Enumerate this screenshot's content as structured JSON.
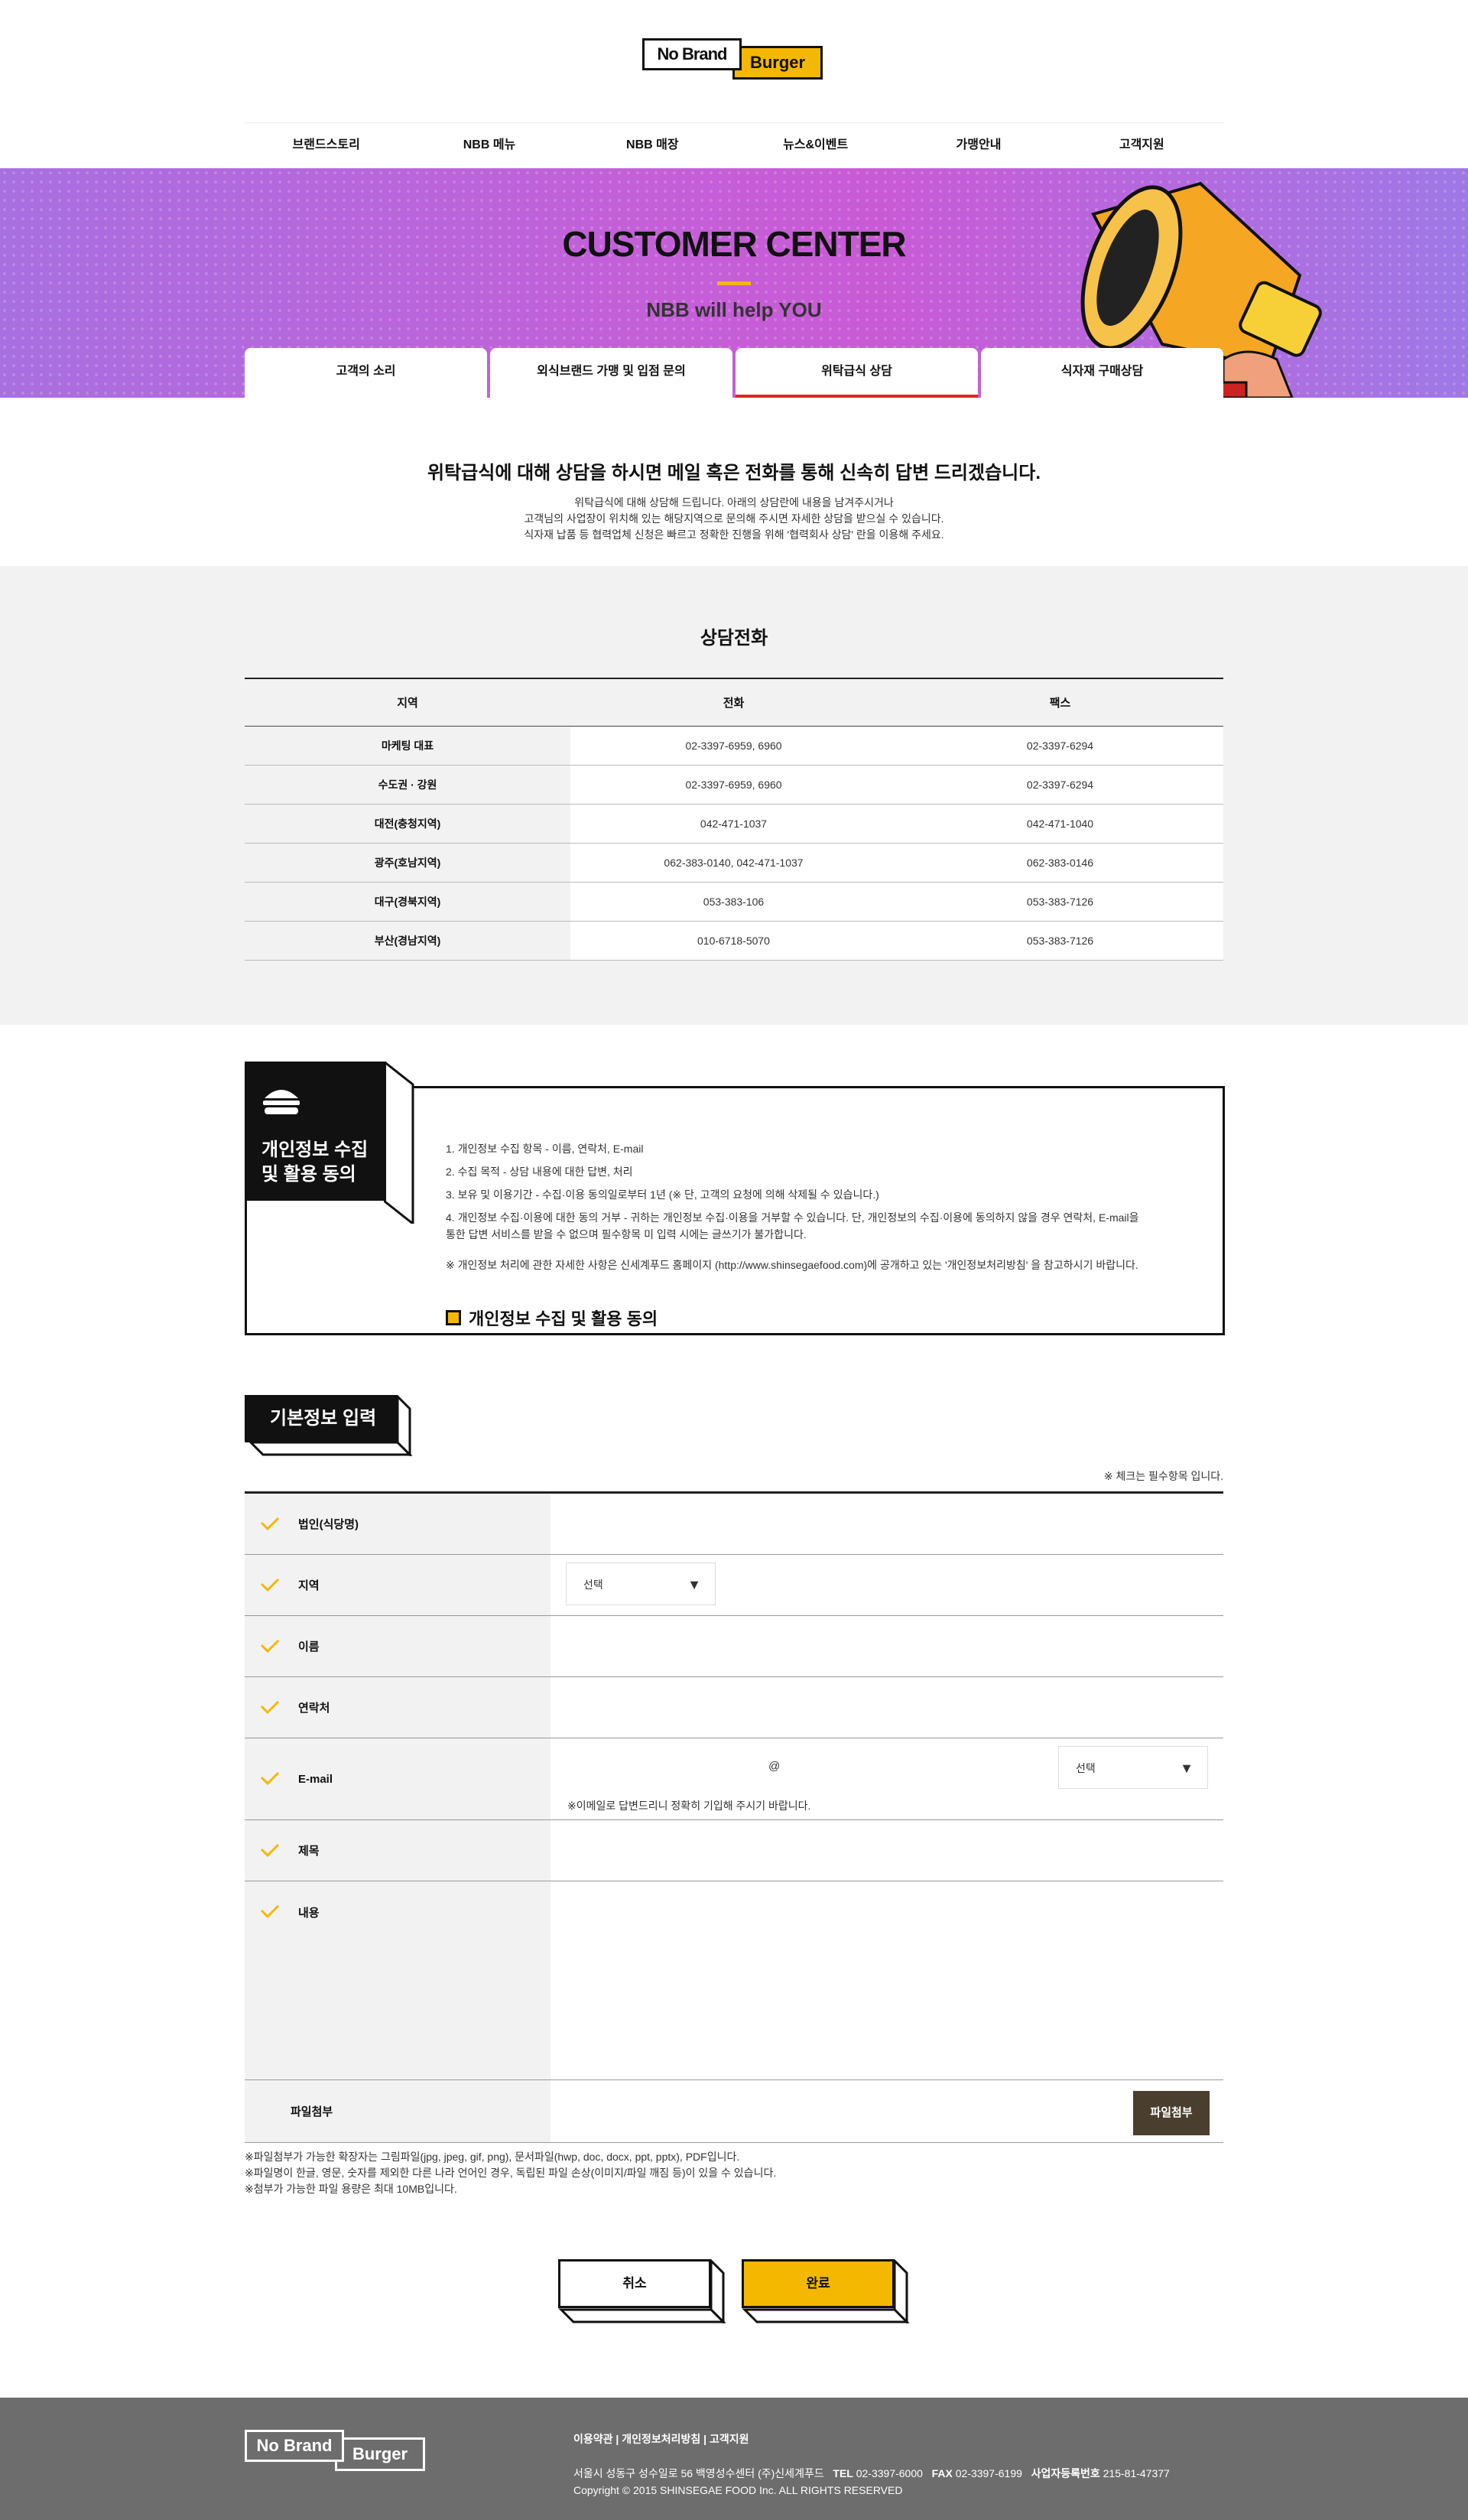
{
  "brand": {
    "logo_left": "No Brand",
    "logo_right": "Burger"
  },
  "nav": [
    "브랜드스토리",
    "NBB 메뉴",
    "NBB 매장",
    "뉴스&이벤트",
    "가맹안내",
    "고객지원"
  ],
  "hero": {
    "title": "CUSTOMER CENTER",
    "subtitle": "NBB will help YOU"
  },
  "tabs": [
    "고객의 소리",
    "외식브랜드 가맹 및 입점 문의",
    "위탁급식 상담",
    "식자재 구매상담"
  ],
  "intro": {
    "heading": "위탁급식에 대해 상담을 하시면 메일 혹은 전화를 통해 신속히 답변 드리겠습니다.",
    "line1": "위탁급식에 대해 상담해 드립니다. 아래의 상담란에 내용을 남겨주시거나",
    "line2": "고객님의 사업장이 위치해 있는 해당지역으로 문의해 주시면 자세한 상담을 받으실 수 있습니다.",
    "line3": "식자재 납품 등 협력업체 신청은 빠르고 정확한 진행을 위해 '협력회사 상담' 란을 이용해 주세요."
  },
  "phone": {
    "title": "상담전화",
    "headers": [
      "지역",
      "전화",
      "팩스"
    ],
    "rows": [
      [
        "마케팅 대표",
        "02-3397-6959, 6960",
        "02-3397-6294"
      ],
      [
        "수도권 · 강원",
        "02-3397-6959, 6960",
        "02-3397-6294"
      ],
      [
        "대전(충청지역)",
        "042-471-1037",
        "042-471-1040"
      ],
      [
        "광주(호남지역)",
        "062-383-0140, 042-471-1037",
        "062-383-0146"
      ],
      [
        "대구(경북지역)",
        "053-383-106",
        "053-383-7126"
      ],
      [
        "부산(경남지역)",
        "010-6718-5070",
        "053-383-7126"
      ]
    ]
  },
  "privacy": {
    "tag_line1": "개인정보 수집",
    "tag_line2": "및 활용 동의",
    "item1": "1. 개인정보 수집 항목  - 이름, 연락처, E-mail",
    "item2": "2. 수집 목적  - 상담 내용에 대한 답변, 처리",
    "item3": "3. 보유 및 이용기간  - 수집·이용 동의일로부터 1년 (※ 단, 고객의 요청에 의해 삭제될 수 있습니다.)",
    "item4a": "4. 개인정보 수집·이용에 대한 동의 거부  - 귀하는 개인정보 수집·이용을 거부할 수 있습니다. 단, 개인정보의 수집·이용에 동의하지 않을 경우 연락처, E-mail을",
    "item4b": "통한 답변 서비스를 받을 수 없으며 필수항목 미 입력 시에는 글쓰기가 불가합니다.",
    "note": "※ 개인정보 처리에 관한 자세한 사항은 신세계푸드 홈페이지 (http://www.shinsegaefood.com)에 공개하고 있는 '개인정보처리방침' 을 참고하시기 바랍니다.",
    "agree_label": "개인정보 수집 및 활용 동의"
  },
  "basic": {
    "tag": "기본정보 입력",
    "required_note": "※ 체크는 필수항목 입니다.",
    "labels": {
      "corp": "법인(식당명)",
      "region": "지역",
      "name": "이름",
      "contact": "연락처",
      "email": "E-mail",
      "subject": "제목",
      "content": "내용",
      "file": "파일첨부"
    },
    "region_select": "선택",
    "email_at": "@",
    "email_select": "선택",
    "email_note": "※이메일로 답변드리니 정확히 기입해 주시기 바랍니다.",
    "file_button": "파일첨부",
    "file_note1": "※파일첨부가 가능한 확장자는 그림파일(jpg, jpeg, gif, png), 문서파일(hwp, doc, docx, ppt, pptx), PDF입니다.",
    "file_note2": "※파일명이 한글, 영문, 숫자를 제외한 다른 나라 언어인 경우, 독립된 파일 손상(이미지/파일 깨짐 등)이 있을 수 있습니다.",
    "file_note3": "※첨부가 가능한 파일 용량은 최대 10MB입니다."
  },
  "buttons": {
    "cancel": "취소",
    "submit": "완료"
  },
  "footer": {
    "link1": "이용약관",
    "link2": "개인정보처리방침",
    "link3": "고객지원",
    "address": "서울시 성동구 성수일로 56 백영성수센터 (주)신세계푸드",
    "tel_label": "TEL",
    "tel": "02-3397-6000",
    "fax_label": "FAX",
    "fax": "02-3397-6199",
    "biz_label": "사업자등록번호",
    "biz": "215-81-47377",
    "copyright": "Copyright © 2015 SHINSEGAE FOOD Inc. ALL RIGHTS RESERVED"
  },
  "colors": {
    "accent": "#f5b800",
    "active_tab": "#e32222",
    "hero_mid": "#c95ad6",
    "footer_bg": "#6d6d6d",
    "file_btn": "#4a3e2e"
  }
}
